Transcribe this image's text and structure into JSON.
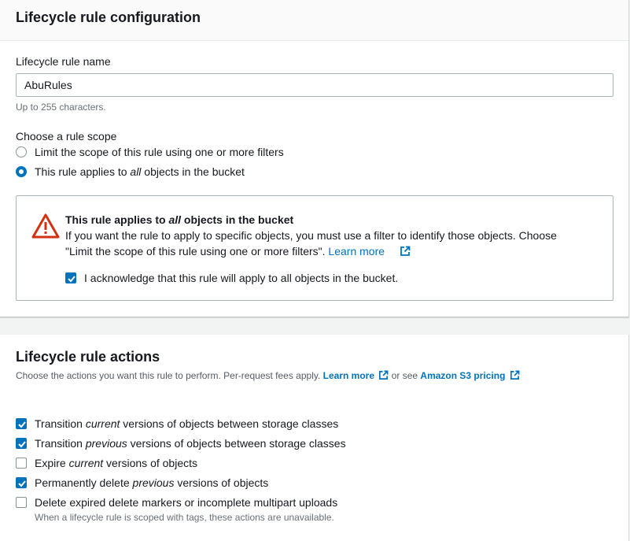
{
  "config": {
    "title": "Lifecycle rule configuration",
    "name_label": "Lifecycle rule name",
    "name_value": "AbuRules",
    "name_hint": "Up to 255 characters.",
    "scope_label": "Choose a rule scope",
    "scope_options": [
      {
        "label": "Limit the scope of this rule using one or more filters",
        "selected": false
      },
      {
        "label_before": "This rule applies to ",
        "label_em": "all",
        "label_after": " objects in the bucket",
        "selected": true
      }
    ],
    "warning": {
      "title_before": "This rule applies to ",
      "title_em": "all",
      "title_after": " objects in the bucket",
      "line1": "If you want the rule to apply to specific objects, you must use a filter to identify those objects. Choose",
      "line2": "\"Limit the scope of this rule using one or more filters\".",
      "learn_more": "Learn more",
      "ack_label": "I acknowledge that this rule will apply to all objects in the bucket.",
      "ack_checked": true
    }
  },
  "actions": {
    "title": "Lifecycle rule actions",
    "desc": "Choose the actions you want this rule to perform. Per-request fees apply.",
    "learn_more": "Learn more",
    "or_see": "or see",
    "pricing": "Amazon S3 pricing",
    "items": [
      {
        "before": "Transition ",
        "em": "current",
        "after": " versions of objects between storage classes",
        "checked": true
      },
      {
        "before": "Transition ",
        "em": "previous",
        "after": " versions of objects between storage classes",
        "checked": true
      },
      {
        "before": "Expire ",
        "em": "current",
        "after": " versions of objects",
        "checked": false
      },
      {
        "before": "Permanently delete ",
        "em": "previous",
        "after": " versions of objects",
        "checked": true
      },
      {
        "before": "Delete expired delete markers or incomplete multipart uploads",
        "em": "",
        "after": "",
        "checked": false
      }
    ],
    "footnote": "When a lifecycle rule is scoped with tags, these actions are unavailable."
  },
  "colors": {
    "accent": "#0073bb",
    "warning": "#d13212",
    "text": "#16191f",
    "muted": "#687078"
  }
}
